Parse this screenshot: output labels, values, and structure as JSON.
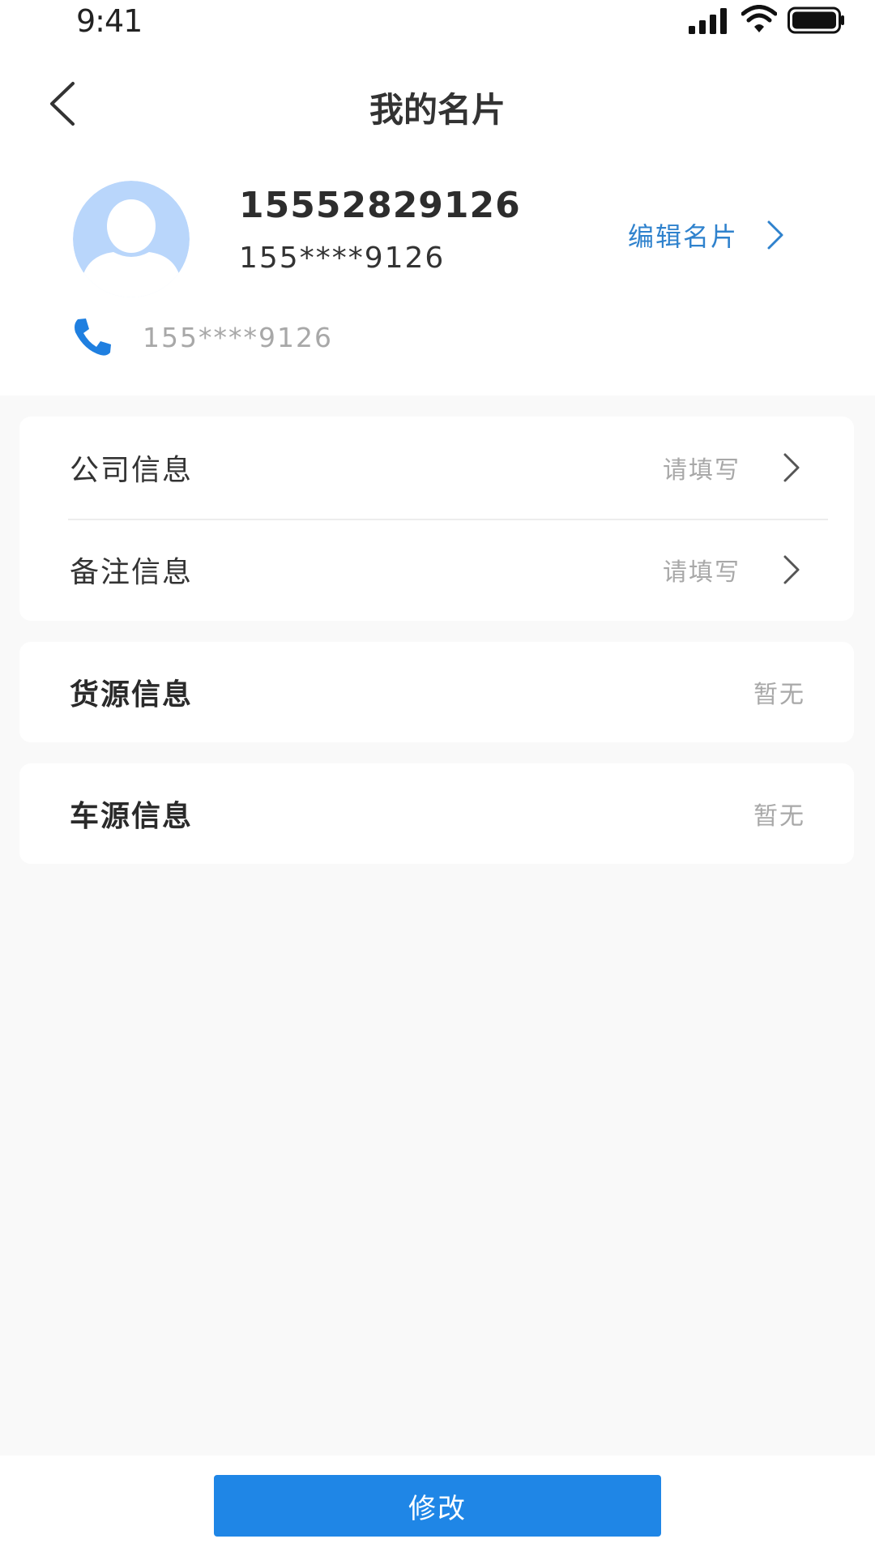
{
  "status_bar": {
    "time": "9:41",
    "icons": [
      "signal-icon",
      "wifi-icon",
      "battery-icon"
    ]
  },
  "header": {
    "title": "我的名片",
    "back_icon": "back-arrow-icon"
  },
  "profile": {
    "name": "15552829126",
    "masked_phone": "155****9126",
    "edit_label": "编辑名片",
    "phone_label": "155****9126",
    "avatar_icon": "default-avatar-icon",
    "phone_icon": "phone-icon"
  },
  "info_rows": [
    {
      "label": "公司信息",
      "value": "请填写"
    },
    {
      "label": "备注信息",
      "value": "请填写"
    }
  ],
  "sections": {
    "cargo": {
      "label": "货源信息",
      "value": "暂无"
    },
    "vehicle": {
      "label": "车源信息",
      "value": "暂无"
    }
  },
  "footer": {
    "modify_label": "修改"
  },
  "colors": {
    "accent": "#1f86e6",
    "link_blue": "#2f82cd",
    "avatar_bg": "#b9d6fb",
    "background": "#f9f9f9"
  }
}
